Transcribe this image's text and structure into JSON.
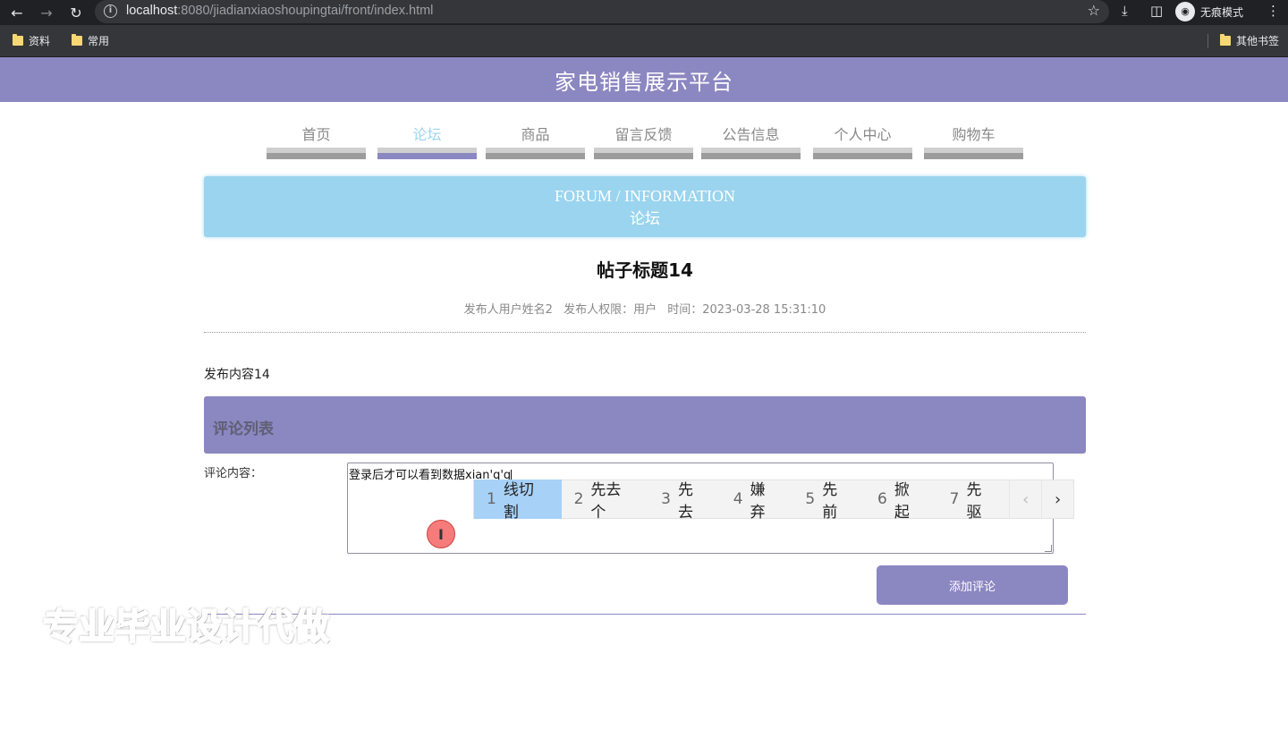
{
  "browser": {
    "url_host": "localhost",
    "url_rest": ":8080/jiadianxiaoshoupingtai/front/index.html",
    "incognito_label": "无痕模式",
    "bookmarks": [
      "资料",
      "常用"
    ],
    "other_bookmarks": "其他书签"
  },
  "site": {
    "title": "家电销售展示平台",
    "nav": [
      {
        "label": "首页",
        "active": false
      },
      {
        "label": "论坛",
        "active": true
      },
      {
        "label": "商品",
        "active": false
      },
      {
        "label": "留言反馈",
        "active": false
      },
      {
        "label": "公告信息",
        "active": false
      },
      {
        "label": "个人中心",
        "active": false
      },
      {
        "label": "购物车",
        "active": false
      }
    ]
  },
  "banner": {
    "en": "FORUM / INFORMATION",
    "cn": "论坛"
  },
  "post": {
    "title": "帖子标题14",
    "author": "发布人用户姓名2",
    "role": "发布人权限：用户",
    "time": "时间：2023-03-28 15:31:10",
    "content": "发布内容14"
  },
  "comments": {
    "header": "评论列表",
    "label": "评论内容：",
    "input_value": "登录后才可以看到数据xian'q'g",
    "submit_label": "添加评论"
  },
  "ime": {
    "candidates": [
      {
        "num": "1",
        "text": "线切割"
      },
      {
        "num": "2",
        "text": "先去个"
      },
      {
        "num": "3",
        "text": "先去"
      },
      {
        "num": "4",
        "text": "嫌弃"
      },
      {
        "num": "5",
        "text": "先前"
      },
      {
        "num": "6",
        "text": "掀起"
      },
      {
        "num": "7",
        "text": "先驱"
      }
    ],
    "prev": "‹",
    "next": "›"
  },
  "watermark": "专业毕业设计代做",
  "colors": {
    "accent": "#8b87c1",
    "banner": "#9bd4ee",
    "nav_active": "#9cd5ee"
  }
}
